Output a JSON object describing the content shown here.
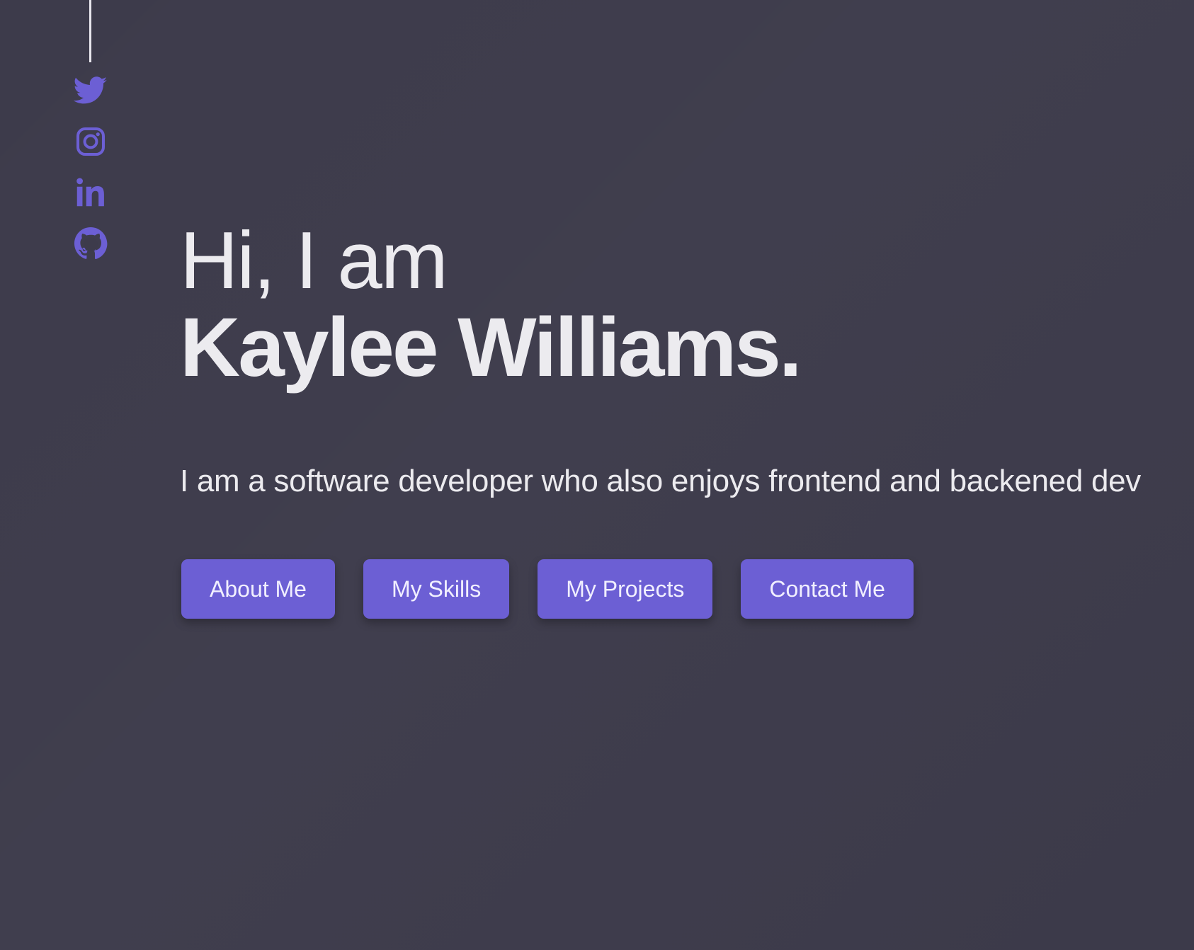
{
  "colors": {
    "background": "#3d3b4b",
    "accent": "#6c5fd4",
    "text": "#ecebef",
    "rail_line": "#e9e7ee"
  },
  "social": [
    {
      "icon": "twitter-icon"
    },
    {
      "icon": "instagram-icon"
    },
    {
      "icon": "linkedin-icon"
    },
    {
      "icon": "github-icon"
    }
  ],
  "hero": {
    "greeting": "Hi, I am",
    "name": "Kaylee Williams.",
    "tagline": "I am a software developer who also enjoys frontend and backened dev"
  },
  "buttons": [
    {
      "label": "About Me"
    },
    {
      "label": "My Skills"
    },
    {
      "label": "My Projects"
    },
    {
      "label": "Contact Me"
    }
  ]
}
